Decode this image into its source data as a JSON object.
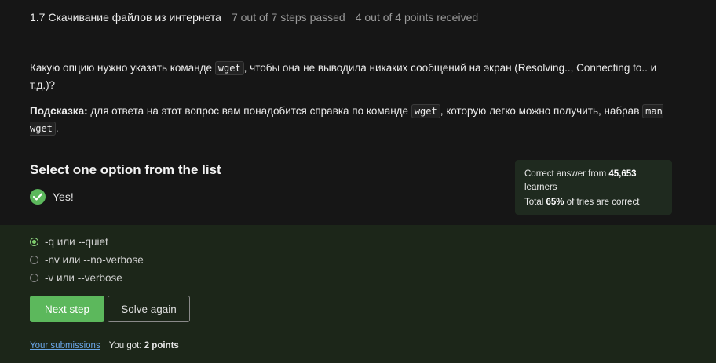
{
  "header": {
    "title": "1.7 Скачивание файлов из интернета",
    "steps": "7 out of 7 steps passed",
    "points": "4 out of 4 points  received"
  },
  "question": {
    "line1_before": "Какую опцию нужно указать команде ",
    "line1_code": "wget",
    "line1_after": ", чтобы она не выводила никаких сообщений на экран (Resolving.., Connecting to.. и т.д.)?",
    "hint_label": "Подсказка:",
    "hint_before": " для ответа на этот вопрос вам понадобится справка по команде ",
    "hint_code1": "wget",
    "hint_middle": ", которую легко можно получить, набрав ",
    "hint_code2": "man wget",
    "hint_after": "."
  },
  "select_title": "Select one option from the list",
  "verdict": {
    "icon": "check-icon",
    "text": "Yes!"
  },
  "stats": {
    "correct_prefix": "Correct answer from ",
    "learners_count": "45,653",
    "learners_suffix": " learners",
    "total_prefix": "Total ",
    "percent": "65%",
    "total_suffix": " of tries are correct"
  },
  "options": [
    {
      "label": "-q или --quiet",
      "selected": true
    },
    {
      "label": "-nv или --no-verbose",
      "selected": false
    },
    {
      "label": "-v или --verbose",
      "selected": false
    }
  ],
  "buttons": {
    "next": "Next step",
    "solve_again": "Solve again"
  },
  "footer": {
    "submissions_link": "Your submissions",
    "you_got_prefix": "You got: ",
    "you_got_value": "2 points"
  },
  "colors": {
    "accent_green": "#5cb85c",
    "link": "#6aa6e8",
    "panel_bg": "#1c2619"
  }
}
